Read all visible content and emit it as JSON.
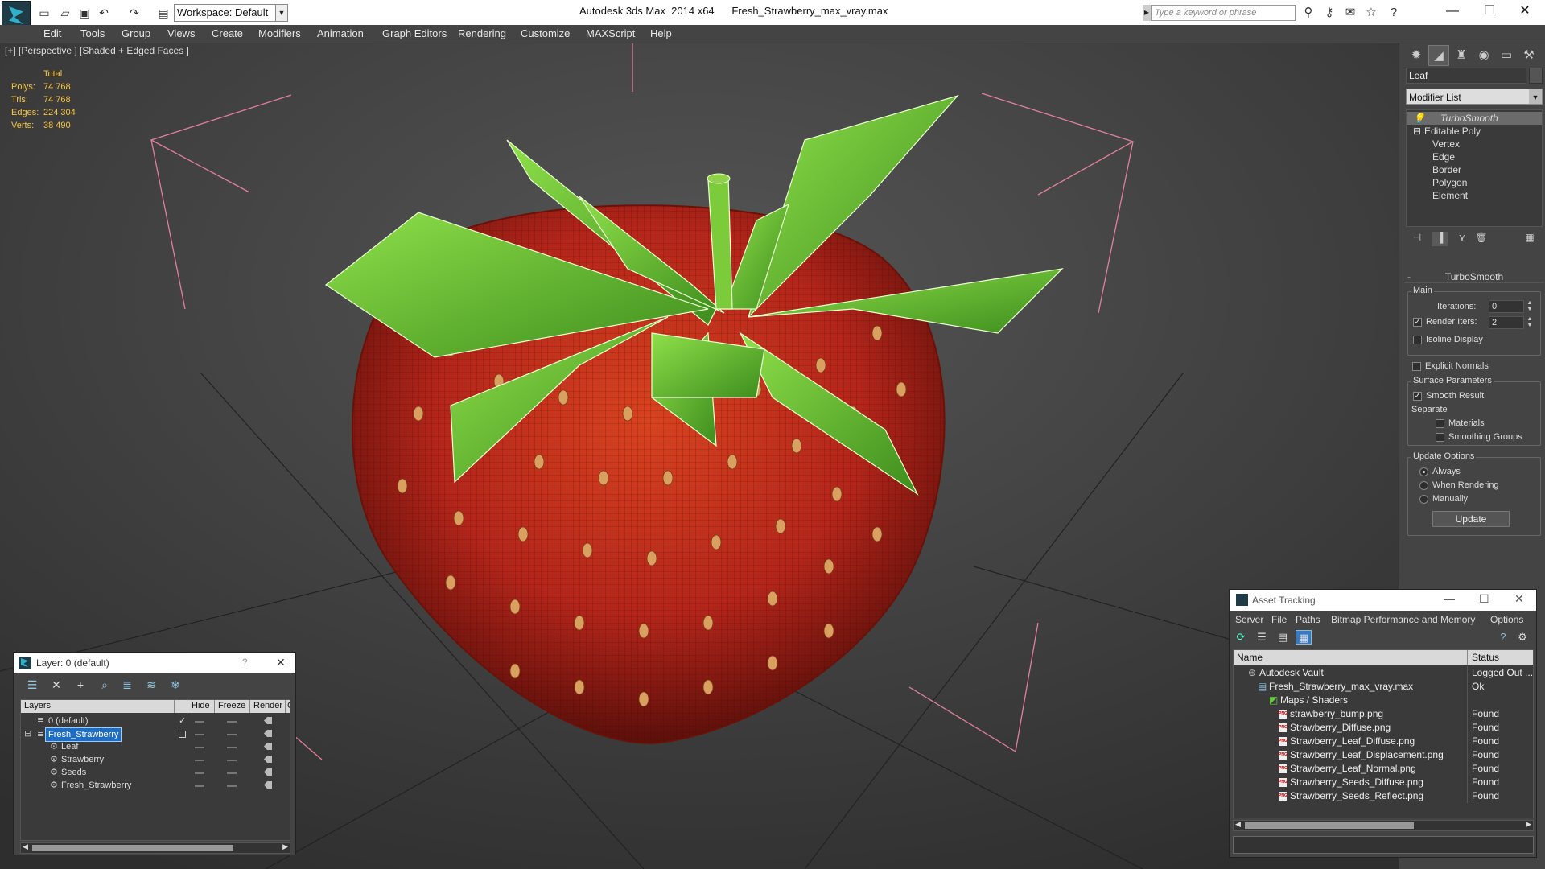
{
  "titlebar": {
    "workspace": "Workspace: Default",
    "app_title": "Autodesk 3ds Max  2014 x64",
    "file_name": "Fresh_Strawberry_max_vray.max",
    "search_placeholder": "Type a keyword or phrase"
  },
  "menu": [
    "Edit",
    "Tools",
    "Group",
    "Views",
    "Create",
    "Modifiers",
    "Animation",
    "Graph Editors",
    "Rendering",
    "Customize",
    "MAXScript",
    "Help"
  ],
  "viewport": {
    "label": "[+] [Perspective ] [Shaded + Edged Faces ]",
    "stats": {
      "header": "Total",
      "polys_label": "Polys:",
      "polys": "74 768",
      "tris_label": "Tris:",
      "tris": "74 768",
      "edges_label": "Edges:",
      "edges": "224 304",
      "verts_label": "Verts:",
      "verts": "38 490"
    }
  },
  "command_panel": {
    "object_name": "Leaf",
    "modifier_list": "Modifier List",
    "stack": [
      "TurboSmooth",
      "Editable Poly",
      "Vertex",
      "Edge",
      "Border",
      "Polygon",
      "Element"
    ],
    "rollout_title": "TurboSmooth",
    "main_group": "Main",
    "iterations_label": "Iterations:",
    "iterations": "0",
    "render_iters_label": "Render Iters:",
    "render_iters": "2",
    "isoline_display": "Isoline Display",
    "explicit_normals": "Explicit Normals",
    "surface_params": "Surface Parameters",
    "smooth_result": "Smooth Result",
    "separate": "Separate",
    "materials": "Materials",
    "smoothing_groups": "Smoothing Groups",
    "update_options": "Update Options",
    "always": "Always",
    "when_rendering": "When Rendering",
    "manually": "Manually",
    "update_button": "Update"
  },
  "layer_window": {
    "title": "Layer: 0 (default)",
    "help": "?",
    "columns": [
      "Layers",
      "Hide",
      "Freeze",
      "Render",
      "C"
    ],
    "rows": [
      "0 (default)",
      "Fresh_Strawberry",
      "Leaf",
      "Strawberry",
      "Seeds",
      "Fresh_Strawberry"
    ]
  },
  "asset_window": {
    "title": "Asset Tracking",
    "menu": [
      "Server",
      "File",
      "Paths",
      "Bitmap Performance and Memory",
      "Options"
    ],
    "columns": [
      "Name",
      "Status"
    ],
    "rows": [
      {
        "name": "Autodesk Vault",
        "status": "Logged Out ..."
      },
      {
        "name": "Fresh_Strawberry_max_vray.max",
        "status": "Ok"
      },
      {
        "name": "Maps / Shaders",
        "status": ""
      },
      {
        "name": "strawberry_bump.png",
        "status": "Found"
      },
      {
        "name": "Strawberry_Diffuse.png",
        "status": "Found"
      },
      {
        "name": "Strawberry_Leaf_Diffuse.png",
        "status": "Found"
      },
      {
        "name": "Strawberry_Leaf_Displacement.png",
        "status": "Found"
      },
      {
        "name": "Strawberry_Leaf_Normal.png",
        "status": "Found"
      },
      {
        "name": "Strawberry_Seeds_Diffuse.png",
        "status": "Found"
      },
      {
        "name": "Strawberry_Seeds_Reflect.png",
        "status": "Found"
      }
    ]
  },
  "colors": {
    "stats_text": "#f4c543",
    "selection": "#1e6cc4",
    "strawberry": "#b4251a",
    "leaf": "#6fc52e",
    "seed": "#d9a060"
  },
  "icons": {
    "app": "3dsmax-logo-icon",
    "search": "binoculars-icon",
    "help": "help-icon"
  }
}
